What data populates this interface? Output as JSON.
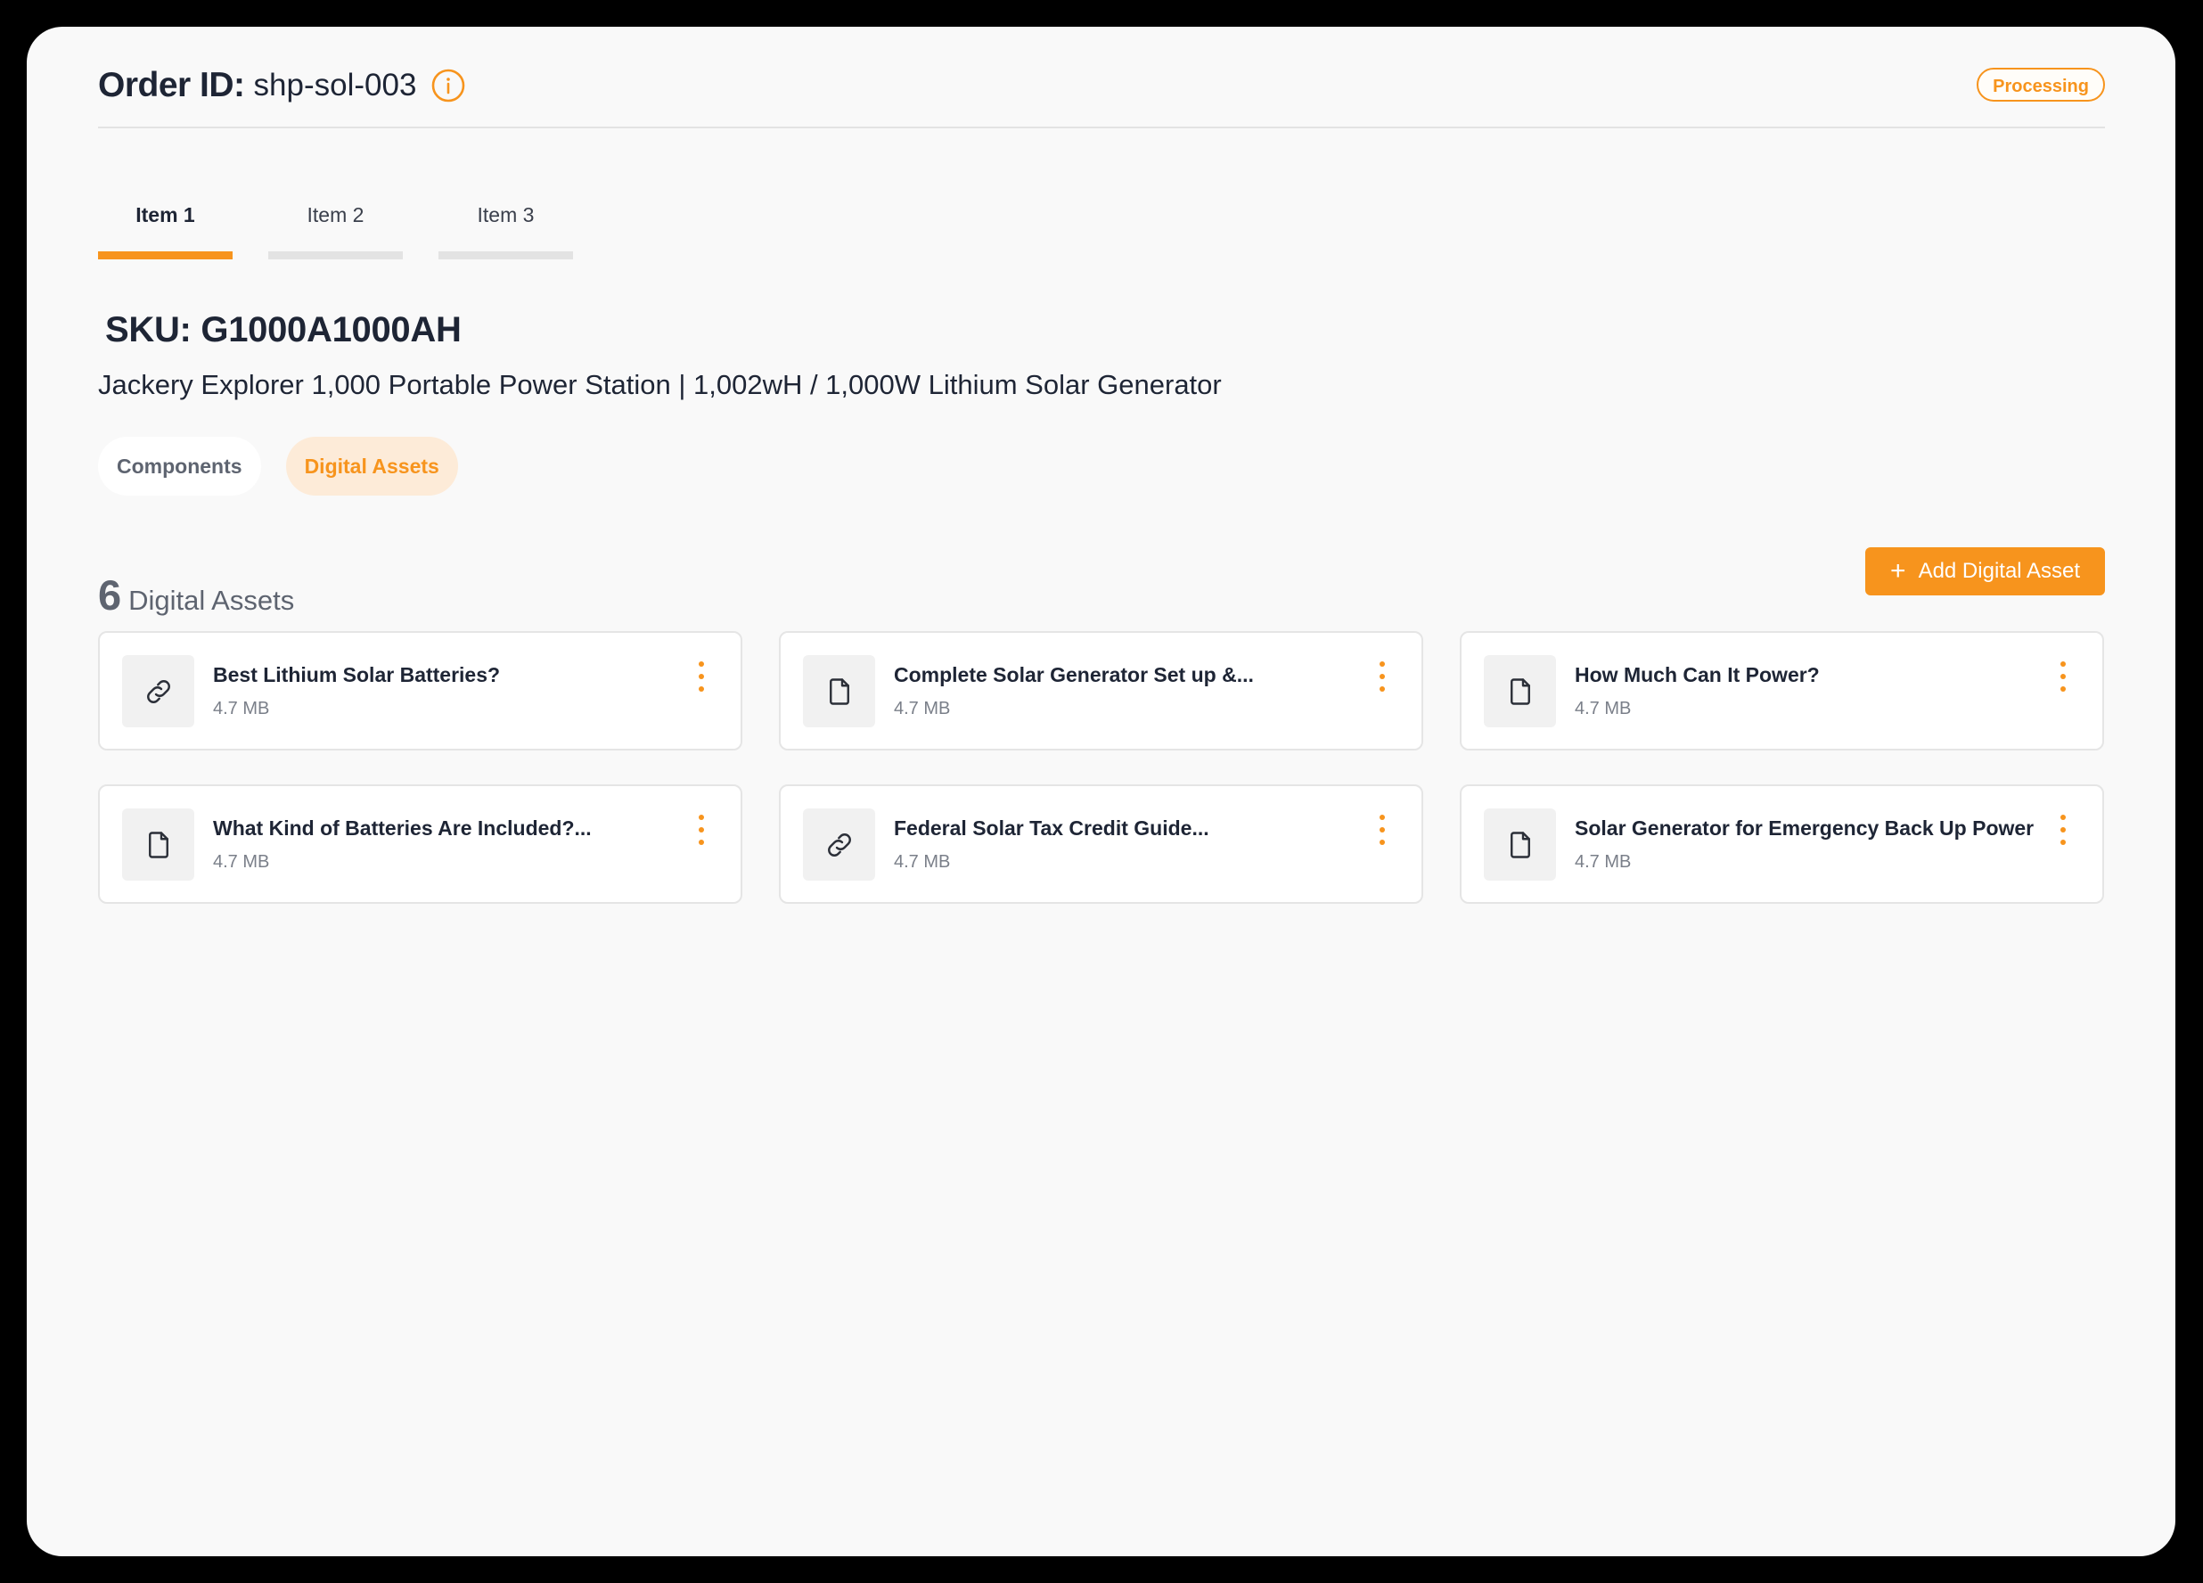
{
  "header": {
    "order_label": "Order ID:",
    "order_id": "shp-sol-003",
    "status": "Processing"
  },
  "item_tabs": [
    {
      "label": "Item 1",
      "active": true
    },
    {
      "label": "Item 2",
      "active": false
    },
    {
      "label": "Item 3",
      "active": false
    }
  ],
  "product": {
    "sku": "SKU: G1000A1000AH",
    "name": "Jackery Explorer 1,000 Portable Power Station | 1,002wH / 1,000W Lithium Solar Generator"
  },
  "view_toggle": {
    "components_label": "Components",
    "digital_assets_label": "Digital Assets",
    "selected": "Digital Assets"
  },
  "assets_section": {
    "count": "6",
    "label": "Digital Assets",
    "add_button_label": "Add Digital Asset"
  },
  "assets": [
    {
      "title": "Best Lithium Solar Batteries?",
      "size": "4.7 MB",
      "icon": "link-icon"
    },
    {
      "title": "Complete Solar Generator Set up &...",
      "size": "4.7 MB",
      "icon": "file-icon"
    },
    {
      "title": "How Much Can It Power?",
      "size": "4.7 MB",
      "icon": "file-icon"
    },
    {
      "title": "What Kind of Batteries Are Included?...",
      "size": "4.7 MB",
      "icon": "file-icon"
    },
    {
      "title": "Federal Solar Tax Credit Guide...",
      "size": "4.7 MB",
      "icon": "link-icon"
    },
    {
      "title": "Solar Generator for Emergency Back Up Power",
      "size": "4.7 MB",
      "icon": "file-icon"
    }
  ],
  "colors": {
    "accent": "#f7941d",
    "text_dark": "#1e2535",
    "text_muted": "#7a7f89",
    "background": "#f9f9f9"
  }
}
